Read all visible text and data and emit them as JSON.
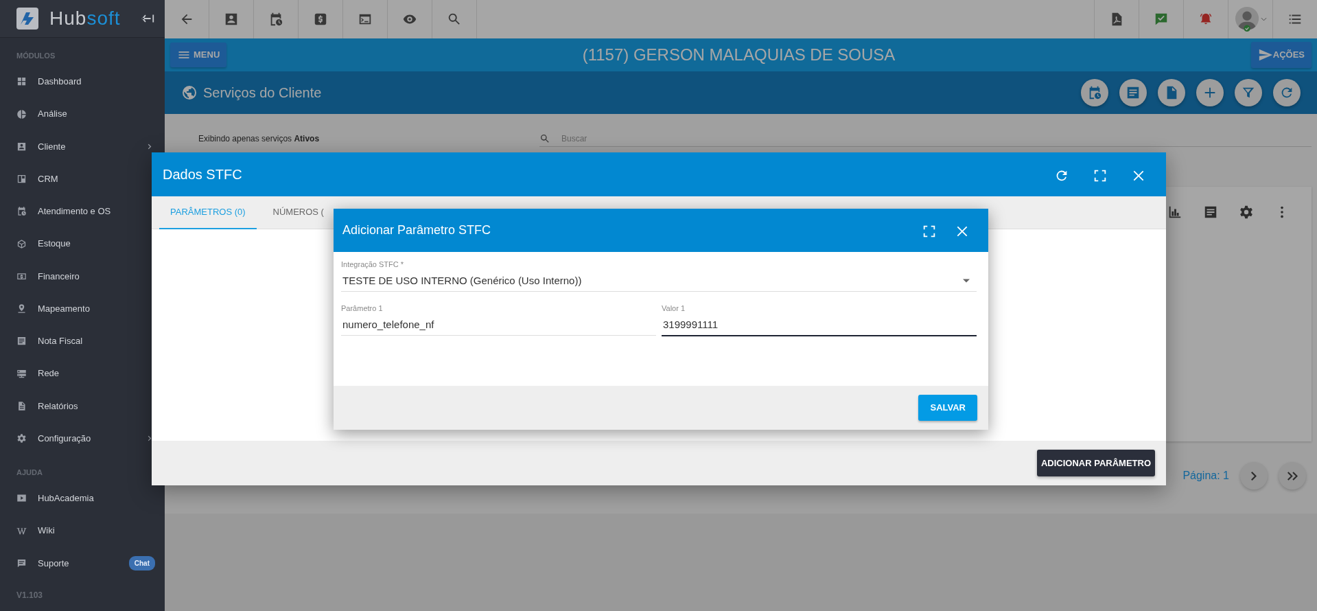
{
  "sidebar": {
    "brand": [
      "Hub",
      "soft"
    ],
    "sections": [
      {
        "title": "MÓDULOS",
        "items": [
          {
            "label": "Dashboard",
            "has_submenu": false
          },
          {
            "label": "Análise",
            "has_submenu": false
          },
          {
            "label": "Cliente",
            "has_submenu": true
          },
          {
            "label": "CRM",
            "has_submenu": false
          },
          {
            "label": "Atendimento e OS",
            "has_submenu": false
          },
          {
            "label": "Estoque",
            "has_submenu": false
          },
          {
            "label": "Financeiro",
            "has_submenu": false
          },
          {
            "label": "Mapeamento",
            "has_submenu": false
          },
          {
            "label": "Nota Fiscal",
            "has_submenu": false
          },
          {
            "label": "Rede",
            "has_submenu": false
          },
          {
            "label": "Relatórios",
            "has_submenu": false
          },
          {
            "label": "Configuração",
            "has_submenu": true
          }
        ]
      },
      {
        "title": "AJUDA",
        "items": [
          {
            "label": "HubAcademia",
            "has_submenu": false
          },
          {
            "label": "Wiki",
            "has_submenu": false
          },
          {
            "label": "Suporte",
            "has_submenu": false,
            "badge": "Chat"
          }
        ]
      }
    ],
    "version": "V1.103"
  },
  "header": {
    "menu_button": "MENU",
    "client_title": "(1157) GERSON MALAQUIAS DE SOUSA",
    "actions_button": "AÇÕES"
  },
  "page": {
    "title": "Serviços do Cliente",
    "filter_text": "Exibindo apenas serviços **Ativos**",
    "search_placeholder": "Buscar",
    "pagination_label": "Página: 1"
  },
  "dialog": {
    "title": "Dados STFC",
    "tabs": [
      {
        "label": "PARÂMETROS (0)",
        "selected": true
      },
      {
        "label": "NÚMEROS (",
        "selected": false
      }
    ],
    "add_button": "ADICIONAR PARÂMETRO"
  },
  "subdialog": {
    "title": "Adicionar Parâmetro STFC",
    "fields": [
      {
        "kind": "select",
        "label": "Integração STFC *",
        "value": "TESTE DE USO INTERNO (Genérico (Uso Interno))",
        "focused": false
      },
      {
        "kind": "text",
        "label": "Parâmetro 1",
        "value": "numero_telefone_nf",
        "focused": false
      },
      {
        "kind": "text",
        "label": "Valor 1",
        "value": "3199991111",
        "focused": true
      }
    ],
    "save_button": "SALVAR"
  }
}
